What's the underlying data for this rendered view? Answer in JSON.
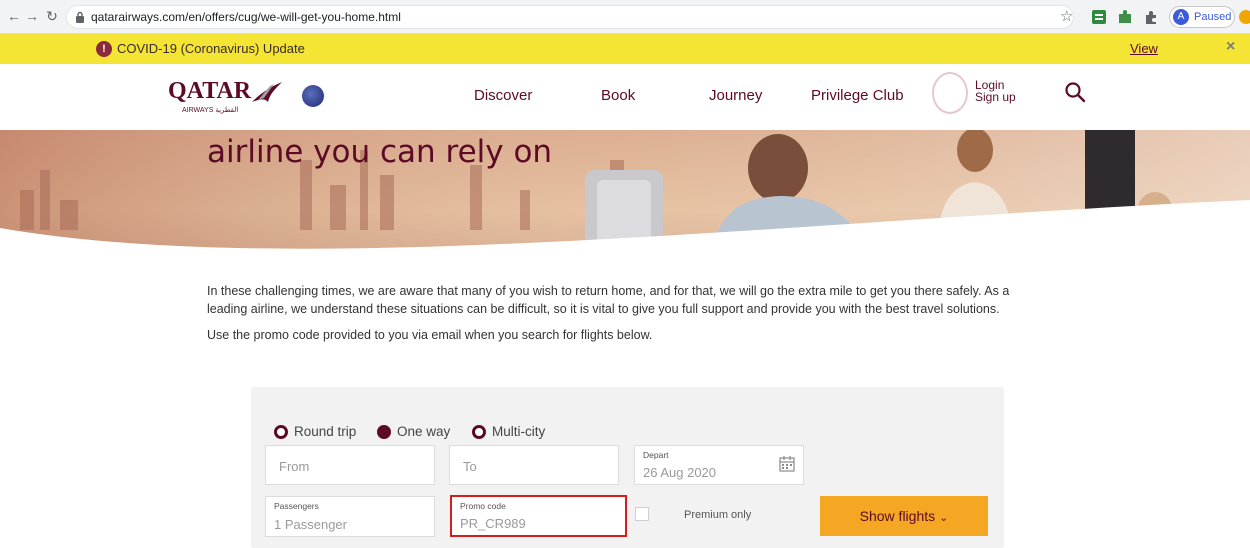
{
  "browser": {
    "url": "qatarairways.com/en/offers/cug/we-will-get-you-home.html",
    "profile_initial": "A",
    "profile_status": "Paused"
  },
  "banner": {
    "text": "COVID-19 (Coronavirus) Update",
    "view_label": "View",
    "close_label": "×"
  },
  "header": {
    "logo_text": "QATAR",
    "logo_subtext": "AIRWAYS القطرية",
    "nav": [
      {
        "label": "Discover"
      },
      {
        "label": "Book"
      },
      {
        "label": "Journey"
      },
      {
        "label": "Privilege Club"
      }
    ],
    "login_label": "Login",
    "signup_label": "Sign up"
  },
  "hero": {
    "title": "airline you can rely on"
  },
  "content": {
    "paragraph1": "In these challenging times, we are aware that many of you wish to return home, and for that, we will go the extra mile to get you there safely. As a leading airline, we understand these situations can be difficult, so it is vital to give you full support and provide you with the best travel solutions.",
    "paragraph2": "Use the promo code provided to you via email when you search for flights below."
  },
  "booking": {
    "trip_types": [
      {
        "label": "Round trip",
        "selected": false
      },
      {
        "label": "One way",
        "selected": true
      },
      {
        "label": "Multi-city",
        "selected": false
      }
    ],
    "from_placeholder": "From",
    "to_placeholder": "To",
    "depart_label": "Depart",
    "depart_value": "26 Aug 2020",
    "passengers_label": "Passengers",
    "passengers_value": "1 Passenger",
    "promo_label": "Promo code",
    "promo_value": "PR_CR989",
    "premium_label": "Premium only",
    "show_button": "Show flights"
  },
  "colors": {
    "brand": "#5c0a26",
    "banner": "#f4e434",
    "button": "#f5a623",
    "highlight": "#d71c1c"
  }
}
